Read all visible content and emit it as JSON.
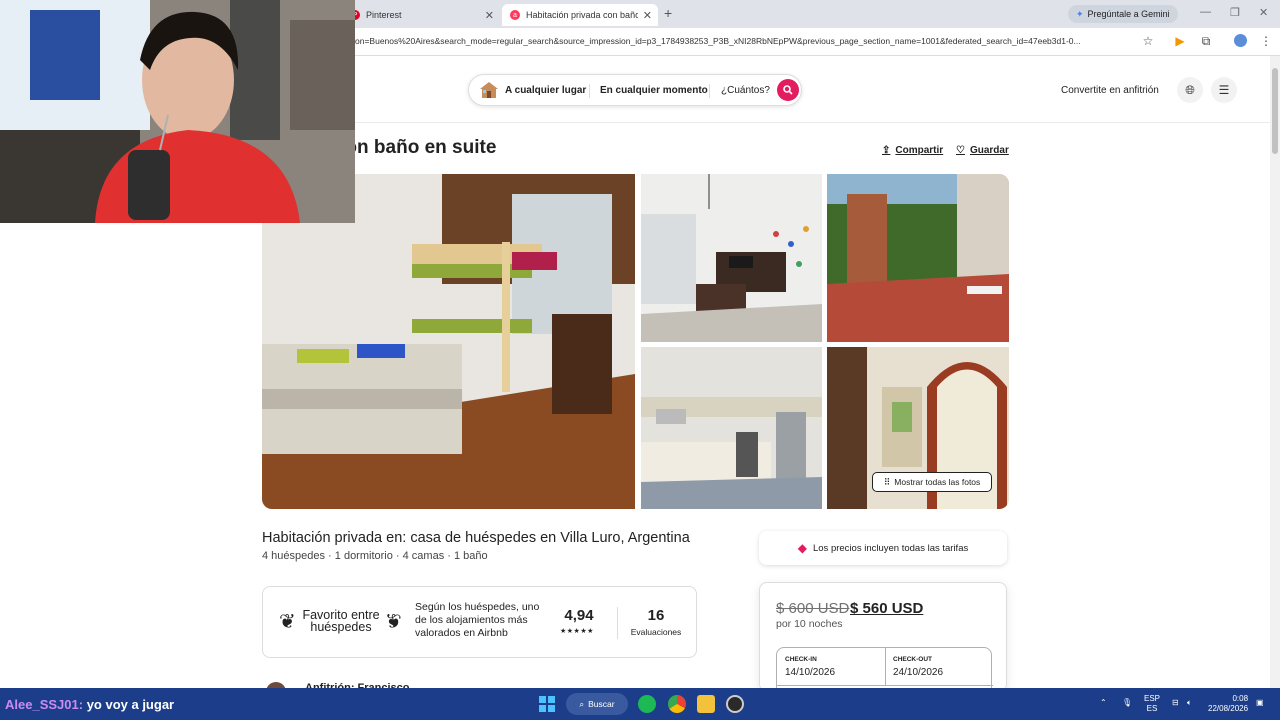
{
  "browser": {
    "tabs": [
      {
        "label": "Pinterest",
        "icon": "pinterest-icon",
        "active": false
      },
      {
        "label": "Habitación privada con baño en",
        "icon": "airbnb-icon",
        "active": true
      }
    ],
    "gemini_label": "Pregúntale a Gemini",
    "url": "on=Buenos%20Aires&search_mode=regular_search&source_impression_id=p3_1784938253_P3B_xNI28RbNEpPW&previous_page_section_name=1001&federated_search_id=47eeb3d1-0..."
  },
  "header": {
    "search": {
      "where": "A cualquier lugar",
      "when": "En cualquier momento",
      "who": "¿Cuántos?"
    },
    "host_link": "Convertite en anfitrión"
  },
  "listing": {
    "title": "privada con baño en suite",
    "share_label": "Compartir",
    "save_label": "Guardar",
    "show_photos_label": "Mostrar todas las fotos",
    "subtitle": "Habitación privada en: casa de huéspedes en Villa Luro, Argentina",
    "details": "4 huéspedes · 1 dormitorio · 4 camas · 1 baño",
    "favorite": {
      "label": "Favorito entre huéspedes",
      "description": "Según los huéspedes, uno de los alojamientos más valorados en Airbnb",
      "rating": "4,94",
      "stars": "★★★★★",
      "reviews_count": "16",
      "reviews_label": "Evaluaciones"
    },
    "host": "Anfitrión: Francisco"
  },
  "booking": {
    "price_note": "Los precios incluyen todas las tarifas",
    "old_price": "$ 600 USD",
    "new_price": "$ 560 USD",
    "per_nights": "por 10 noches",
    "checkin_label": "CHECK-IN",
    "checkin_value": "14/10/2026",
    "checkout_label": "CHECK-OUT",
    "checkout_value": "24/10/2026"
  },
  "taskbar": {
    "chat_user": "Alee_SSJ01:",
    "chat_message": "yo voy a jugar",
    "search_label": "Buscar",
    "lang_top": "ESP",
    "lang_bottom": "ES",
    "time": "0:08",
    "date": "22/08/2026"
  },
  "colors": {
    "brand": "#e31c5f",
    "taskbar": "#1c3e8a"
  }
}
